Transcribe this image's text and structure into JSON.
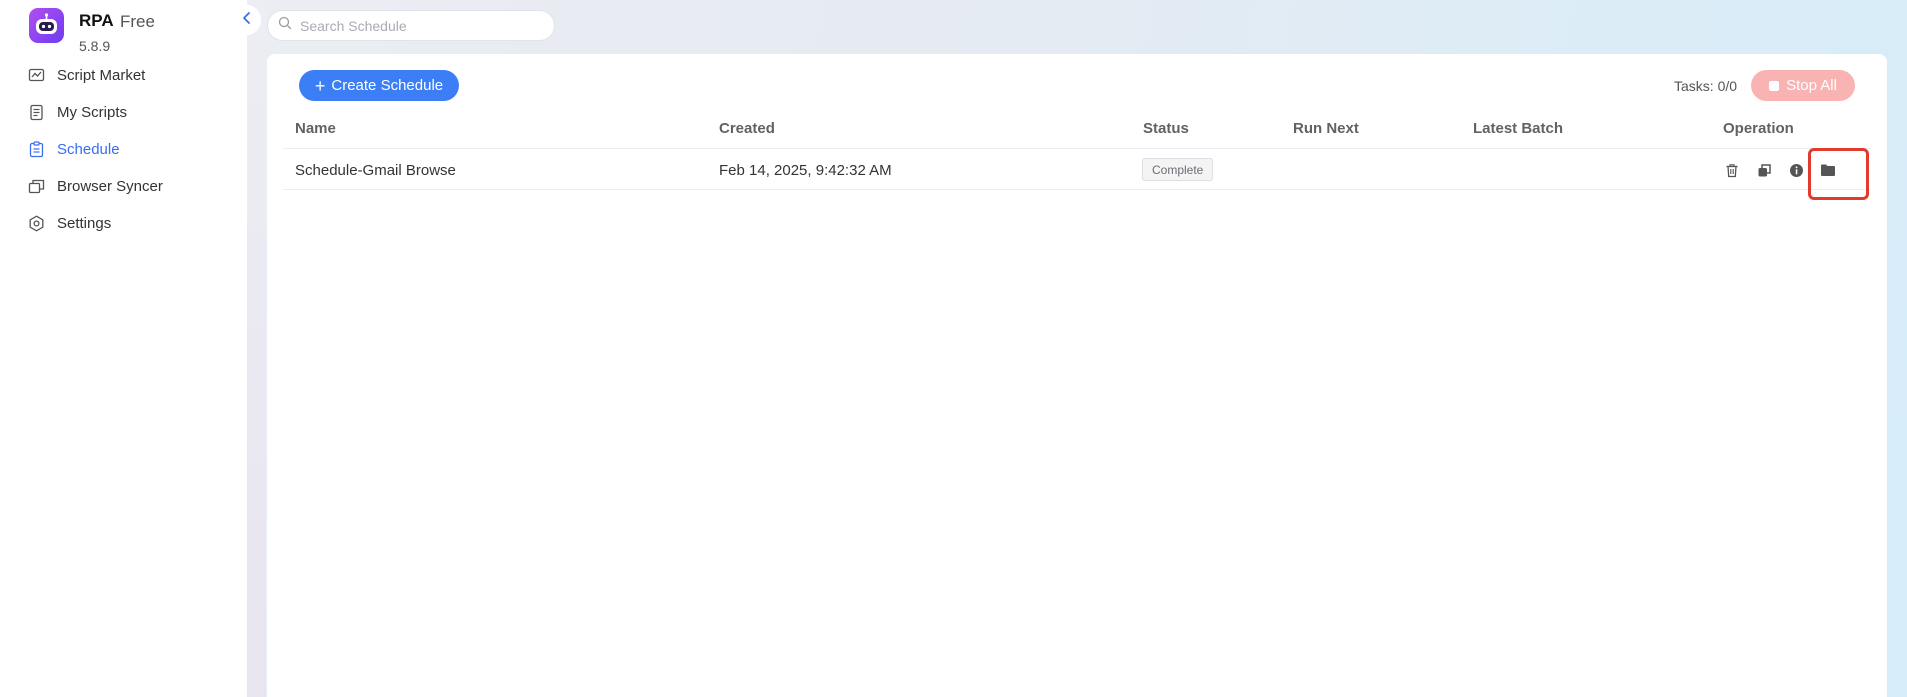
{
  "app": {
    "name": "RPA",
    "tier": "Free",
    "version": "5.8.9"
  },
  "sidebar": {
    "items": [
      {
        "label": "Script Market",
        "icon": "chart-icon",
        "active": false
      },
      {
        "label": "My Scripts",
        "icon": "document-icon",
        "active": false
      },
      {
        "label": "Schedule",
        "icon": "clipboard-icon",
        "active": true
      },
      {
        "label": "Browser Syncer",
        "icon": "windows-icon",
        "active": false
      },
      {
        "label": "Settings",
        "icon": "gear-icon",
        "active": false
      }
    ]
  },
  "search": {
    "placeholder": "Search Schedule",
    "value": ""
  },
  "toolbar": {
    "create_label": "Create Schedule",
    "tasks_label": "Tasks: 0/0",
    "stop_label": "Stop All"
  },
  "table": {
    "columns": [
      "Name",
      "Created",
      "Status",
      "Run Next",
      "Latest Batch",
      "Operation"
    ],
    "rows": [
      {
        "name": "Schedule-Gmail Browse",
        "created": "Feb 14, 2025, 9:42:32 AM",
        "status": "Complete",
        "run_next": "",
        "latest_batch": ""
      }
    ]
  },
  "colors": {
    "accent": "#3c7ef5",
    "stop": "#f9b3b3",
    "highlight": "#e23b2e"
  }
}
